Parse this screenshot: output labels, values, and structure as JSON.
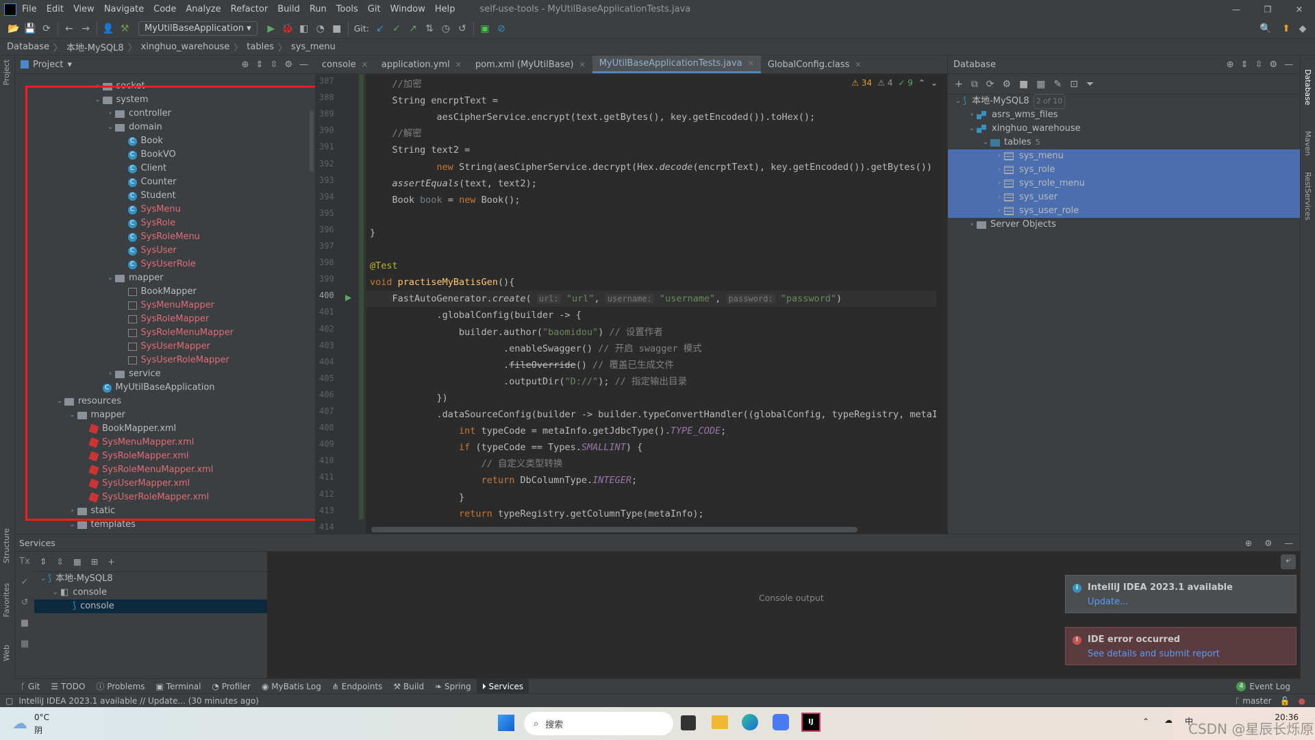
{
  "app": {
    "title": "self-use-tools - MyUtilBaseApplicationTests.java",
    "logo": "IJ"
  },
  "menu": [
    "File",
    "Edit",
    "View",
    "Navigate",
    "Code",
    "Analyze",
    "Refactor",
    "Build",
    "Run",
    "Tools",
    "Git",
    "Window",
    "Help"
  ],
  "toolbar": {
    "run_config": "MyUtilBaseApplication",
    "git_label": "Git:"
  },
  "breadcrumb": [
    "Database",
    "本地-MySQL8",
    "xinghuo_warehouse",
    "tables",
    "sys_menu"
  ],
  "left_strip": [
    "Project",
    "Structure",
    "Favorites",
    "Web"
  ],
  "right_strip": [
    "Database",
    "Maven",
    "RestServices"
  ],
  "project": {
    "title": "Project",
    "tree": [
      {
        "label": "socket",
        "depth": 3,
        "arrow": ">",
        "icon": "folder"
      },
      {
        "label": "system",
        "depth": 3,
        "arrow": "v",
        "icon": "folder"
      },
      {
        "label": "controller",
        "depth": 4,
        "arrow": ">",
        "icon": "folder"
      },
      {
        "label": "domain",
        "depth": 4,
        "arrow": "v",
        "icon": "folder"
      },
      {
        "label": "Book",
        "depth": 5,
        "icon": "class"
      },
      {
        "label": "BookVO",
        "depth": 5,
        "icon": "class"
      },
      {
        "label": "Client",
        "depth": 5,
        "icon": "class"
      },
      {
        "label": "Counter",
        "depth": 5,
        "icon": "class"
      },
      {
        "label": "Student",
        "depth": 5,
        "icon": "class"
      },
      {
        "label": "SysMenu",
        "depth": 5,
        "icon": "class",
        "red": true
      },
      {
        "label": "SysRole",
        "depth": 5,
        "icon": "class",
        "red": true
      },
      {
        "label": "SysRoleMenu",
        "depth": 5,
        "icon": "class",
        "red": true
      },
      {
        "label": "SysUser",
        "depth": 5,
        "icon": "class",
        "red": true
      },
      {
        "label": "SysUserRole",
        "depth": 5,
        "icon": "class",
        "red": true
      },
      {
        "label": "mapper",
        "depth": 4,
        "arrow": "v",
        "icon": "folder"
      },
      {
        "label": "BookMapper",
        "depth": 5,
        "icon": "mapper"
      },
      {
        "label": "SysMenuMapper",
        "depth": 5,
        "icon": "mapper",
        "red": true
      },
      {
        "label": "SysRoleMapper",
        "depth": 5,
        "icon": "mapper",
        "red": true
      },
      {
        "label": "SysRoleMenuMapper",
        "depth": 5,
        "icon": "mapper",
        "red": true
      },
      {
        "label": "SysUserMapper",
        "depth": 5,
        "icon": "mapper",
        "red": true
      },
      {
        "label": "SysUserRoleMapper",
        "depth": 5,
        "icon": "mapper",
        "red": true
      },
      {
        "label": "service",
        "depth": 4,
        "arrow": ">",
        "icon": "folder"
      },
      {
        "label": "MyUtilBaseApplication",
        "depth": 3,
        "icon": "class"
      },
      {
        "label": "resources",
        "depth": 0,
        "arrow": "v",
        "icon": "folder"
      },
      {
        "label": "mapper",
        "depth": 1,
        "arrow": "v",
        "icon": "folder"
      },
      {
        "label": "BookMapper.xml",
        "depth": 2,
        "icon": "xml"
      },
      {
        "label": "SysMenuMapper.xml",
        "depth": 2,
        "icon": "xml",
        "red": true
      },
      {
        "label": "SysRoleMapper.xml",
        "depth": 2,
        "icon": "xml",
        "red": true
      },
      {
        "label": "SysRoleMenuMapper.xml",
        "depth": 2,
        "icon": "xml",
        "red": true
      },
      {
        "label": "SysUserMapper.xml",
        "depth": 2,
        "icon": "xml",
        "red": true
      },
      {
        "label": "SysUserRoleMapper.xml",
        "depth": 2,
        "icon": "xml",
        "red": true
      },
      {
        "label": "static",
        "depth": 1,
        "arrow": ">",
        "icon": "folder"
      },
      {
        "label": "templates",
        "depth": 1,
        "arrow": "v",
        "icon": "folder"
      }
    ]
  },
  "editor": {
    "tabs": [
      {
        "label": "console"
      },
      {
        "label": "application.yml"
      },
      {
        "label": "pom.xml (MyUtilBase)"
      },
      {
        "label": "MyUtilBaseApplicationTests.java",
        "active": true
      },
      {
        "label": "GlobalConfig.class"
      }
    ],
    "inspections": {
      "warnings": "34",
      "weak_warnings": "4",
      "typos": "9"
    },
    "first_line": 387,
    "current_line": 400,
    "lines": [
      [
        [
          "    //加密",
          "cm"
        ]
      ],
      [
        [
          "    String "
        ],
        [
          "encrptText"
        ],
        [
          " ="
        ]
      ],
      [
        [
          "            aesCipherService.encrypt(text.getBytes(), key.getEncoded()).toHex();"
        ]
      ],
      [
        [
          "    //解密",
          "cm"
        ]
      ],
      [
        [
          "    String text2 ="
        ]
      ],
      [
        [
          "            "
        ],
        [
          "new",
          "kw"
        ],
        [
          " String(aesCipherService.decrypt(Hex."
        ],
        [
          "decode",
          "it"
        ],
        [
          "(encrptText), key.getEncoded()).getBytes())"
        ]
      ],
      [
        [
          "    "
        ],
        [
          "assertEquals",
          "it"
        ],
        [
          "(text, text2);"
        ]
      ],
      [
        [
          "    Book "
        ],
        [
          "book",
          "dim"
        ],
        [
          " = "
        ],
        [
          "new",
          "kw"
        ],
        [
          " Book();"
        ]
      ],
      [
        [
          ""
        ]
      ],
      [
        [
          "}"
        ]
      ],
      [
        [
          ""
        ]
      ],
      [
        [
          "@Test",
          "an"
        ]
      ],
      [
        [
          "void",
          "kw"
        ],
        [
          " "
        ],
        [
          "practiseMyBatisGen",
          "mth"
        ],
        [
          "(){"
        ]
      ],
      [
        [
          "    FastAutoGenerator."
        ],
        [
          "create",
          "it"
        ],
        [
          "( "
        ],
        [
          "url:",
          "hint"
        ],
        [
          " "
        ],
        [
          "\"url\"",
          "str"
        ],
        [
          ", "
        ],
        [
          "username:",
          "hint"
        ],
        [
          " "
        ],
        [
          "\"username\"",
          "str"
        ],
        [
          ", "
        ],
        [
          "password:",
          "hint"
        ],
        [
          " "
        ],
        [
          "\"password\"",
          "str"
        ],
        [
          ")"
        ]
      ],
      [
        [
          "            .globalConfig(builder -> {"
        ]
      ],
      [
        [
          "                builder.author("
        ],
        [
          "\"baomidou\"",
          "str"
        ],
        [
          ") "
        ],
        [
          "// 设置作者",
          "cm"
        ]
      ],
      [
        [
          "                        .enableSwagger() "
        ],
        [
          "// 开启 swagger 模式",
          "cm"
        ]
      ],
      [
        [
          "                        ."
        ],
        [
          "fileOverride",
          "strike"
        ],
        [
          "() "
        ],
        [
          "// 覆盖已生成文件",
          "cm"
        ]
      ],
      [
        [
          "                        .outputDir("
        ],
        [
          "\"D://\"",
          "str"
        ],
        [
          "); "
        ],
        [
          "// 指定输出目录",
          "cm"
        ]
      ],
      [
        [
          "            })"
        ]
      ],
      [
        [
          "            .dataSourceConfig(builder -> builder.typeConvertHandler((globalConfig, typeRegistry, metaInfo) -> {"
        ]
      ],
      [
        [
          "                "
        ],
        [
          "int",
          "kw"
        ],
        [
          " typeCode = metaInfo.getJdbcType()."
        ],
        [
          "TYPE_CODE",
          "st"
        ],
        [
          ";"
        ]
      ],
      [
        [
          "                "
        ],
        [
          "if",
          "kw"
        ],
        [
          " (typeCode == Types."
        ],
        [
          "SMALLINT",
          "st"
        ],
        [
          ") {"
        ]
      ],
      [
        [
          "                    "
        ],
        [
          "// 自定义类型转换",
          "cm"
        ]
      ],
      [
        [
          "                    "
        ],
        [
          "return",
          "kw"
        ],
        [
          " DbColumnType."
        ],
        [
          "INTEGER",
          "st"
        ],
        [
          ";"
        ]
      ],
      [
        [
          "                }"
        ]
      ],
      [
        [
          "                "
        ],
        [
          "return",
          "kw"
        ],
        [
          " typeRegistry.getColumnType(metaInfo);"
        ]
      ],
      [
        [
          ""
        ]
      ]
    ]
  },
  "database": {
    "title": "Database",
    "tree": [
      {
        "label": "本地-MySQL8",
        "depth": 0,
        "arrow": "v",
        "icon": "mysql",
        "badge": "2 of 10"
      },
      {
        "label": "asrs_wms_files",
        "depth": 1,
        "arrow": ">",
        "icon": "schema"
      },
      {
        "label": "xinghuo_warehouse",
        "depth": 1,
        "arrow": "v",
        "icon": "schema"
      },
      {
        "label": "tables",
        "depth": 2,
        "arrow": "v",
        "icon": "folder",
        "count": "5"
      },
      {
        "label": "sys_menu",
        "depth": 3,
        "arrow": ">",
        "icon": "table",
        "selected": true
      },
      {
        "label": "sys_role",
        "depth": 3,
        "arrow": ">",
        "icon": "table",
        "selected": true
      },
      {
        "label": "sys_role_menu",
        "depth": 3,
        "arrow": ">",
        "icon": "table",
        "selected": true
      },
      {
        "label": "sys_user",
        "depth": 3,
        "arrow": ">",
        "icon": "table",
        "selected": true
      },
      {
        "label": "sys_user_role",
        "depth": 3,
        "arrow": ">",
        "icon": "table",
        "selected": true
      },
      {
        "label": "Server Objects",
        "depth": 1,
        "arrow": ">",
        "icon": "folder"
      }
    ]
  },
  "services": {
    "title": "Services",
    "tree": [
      {
        "label": "本地-MySQL8",
        "depth": 0,
        "arrow": "v"
      },
      {
        "label": "console",
        "depth": 1,
        "arrow": "v"
      },
      {
        "label": "console",
        "depth": 2,
        "selected": true
      }
    ],
    "console_placeholder": "Console output"
  },
  "notifications": [
    {
      "title": "IntelliJ IDEA 2023.1 available",
      "link": "Update...",
      "type": "info"
    },
    {
      "title": "IDE error occurred",
      "link": "See details and submit report",
      "type": "error"
    }
  ],
  "tool_tabs": [
    "Git",
    "TODO",
    "Problems",
    "Terminal",
    "Profiler",
    "MyBatis Log",
    "Endpoints",
    "Build",
    "Spring",
    "Services"
  ],
  "active_tool_tab": "Services",
  "event_log": {
    "count": "4",
    "label": "Event Log"
  },
  "status": {
    "message": "IntelliJ IDEA 2023.1 available // Update... (30 minutes ago)",
    "branch": "master"
  },
  "taskbar": {
    "weather_temp": "0°C",
    "weather_desc": "阴",
    "search_placeholder": "搜索",
    "time": "20:36",
    "watermark": "CSDN @星辰长烁原"
  }
}
